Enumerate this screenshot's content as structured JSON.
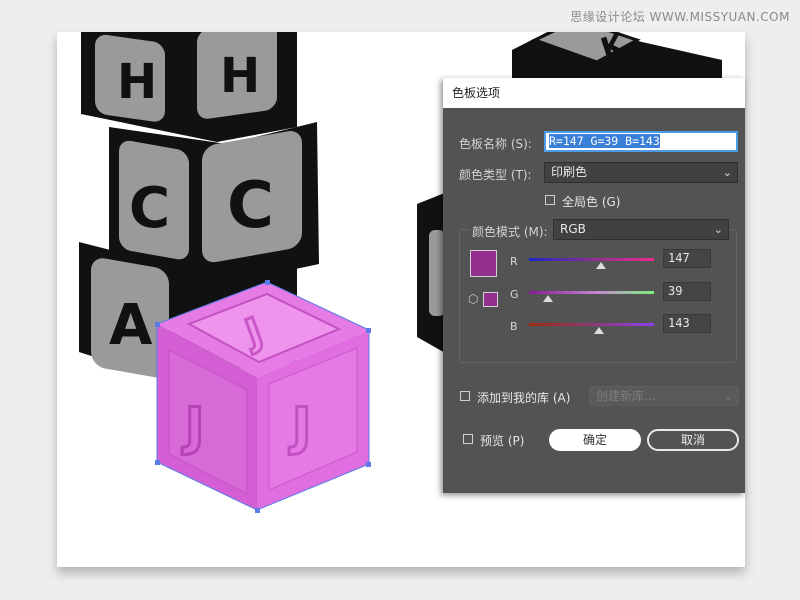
{
  "watermark": "思缘设计论坛  WWW.MISSYUAN.COM",
  "artwork": {
    "blocks": [
      {
        "letter": "H"
      },
      {
        "letter": "H"
      },
      {
        "letter": "C"
      },
      {
        "letter": "C"
      },
      {
        "letter": "A"
      },
      {
        "letter": "K"
      },
      {
        "letter": "J"
      },
      {
        "letter": "J"
      },
      {
        "letter": "J"
      }
    ],
    "selected_cube_color": "#932f8f",
    "selection_color": "#5b7ce8"
  },
  "dialog": {
    "title": "色板选项",
    "swatch_name_label": "色板名称 (S):",
    "swatch_name_value": "R=147 G=39 B=143",
    "color_type_label": "颜色类型 (T):",
    "color_type_value": "印刷色",
    "global_label": "全局色 (G)",
    "color_mode_label": "颜色模式 (M):",
    "color_mode_value": "RGB",
    "channels": [
      {
        "name": "R",
        "value": "147",
        "fraction": 0.576
      },
      {
        "name": "G",
        "value": "39",
        "fraction": 0.153
      },
      {
        "name": "B",
        "value": "143",
        "fraction": 0.561
      }
    ],
    "swatch_color": "#932f8f",
    "add_to_library_label": "添加到我的库 (A)",
    "library_placeholder": "创建新库...",
    "preview_label": "预览 (P)",
    "ok_label": "确定",
    "cancel_label": "取消"
  }
}
